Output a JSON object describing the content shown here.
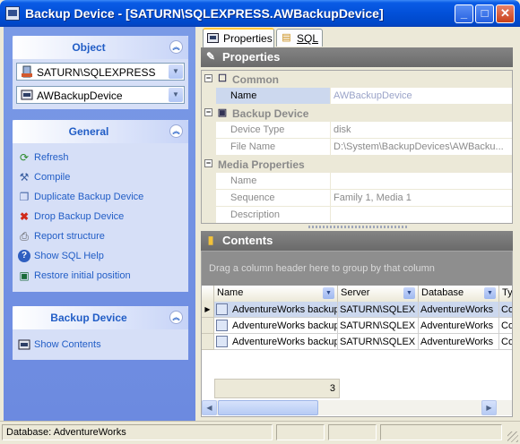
{
  "window": {
    "title": "Backup Device - [SATURN\\SQLEXPRESS.AWBackupDevice]",
    "min_glyph": "_",
    "max_glyph": "□",
    "close_glyph": "✕"
  },
  "left_pane": {
    "object_panel": {
      "title": "Object",
      "server": "SATURN\\SQLEXPRESS",
      "device": "AWBackupDevice"
    },
    "general_panel": {
      "title": "General",
      "items": [
        {
          "label": "Refresh",
          "icon": "refresh-icon"
        },
        {
          "label": "Compile",
          "icon": "compile-icon"
        },
        {
          "label": "Duplicate Backup Device",
          "icon": "duplicate-icon"
        },
        {
          "label": "Drop Backup Device",
          "icon": "drop-icon"
        },
        {
          "label": "Report structure",
          "icon": "report-icon"
        },
        {
          "label": "Show SQL Help",
          "icon": "help-icon"
        },
        {
          "label": "Restore initial position",
          "icon": "restore-icon"
        }
      ]
    },
    "backup_panel": {
      "title": "Backup Device",
      "items": [
        {
          "label": "Show Contents",
          "icon": "show-contents-icon"
        }
      ]
    }
  },
  "tabs": [
    {
      "label": "Properties",
      "active": true
    },
    {
      "label": "SQL",
      "active": false
    }
  ],
  "properties": {
    "title": "Properties",
    "categories": [
      {
        "name": "Common",
        "rows": [
          {
            "name": "Name",
            "value": "AWBackupDevice",
            "selected": true
          }
        ]
      },
      {
        "name": "Backup Device",
        "rows": [
          {
            "name": "Device Type",
            "value": "disk"
          },
          {
            "name": "File Name",
            "value": "D:\\System\\BackupDevices\\AWBacku..."
          }
        ]
      },
      {
        "name": "Media Properties",
        "rows": [
          {
            "name": "Name",
            "value": ""
          },
          {
            "name": "Sequence",
            "value": "Family 1, Media 1"
          },
          {
            "name": "Description",
            "value": ""
          }
        ]
      }
    ]
  },
  "contents": {
    "title": "Contents",
    "group_hint": "Drag a column header here to group by that column",
    "columns": [
      "Name",
      "Server",
      "Database",
      "Ty"
    ],
    "rows": [
      [
        "AdventureWorks backup",
        "SATURN\\SQLEX",
        "AdventureWorks",
        "Co"
      ],
      [
        "AdventureWorks backup",
        "SATURN\\SQLEX",
        "AdventureWorks",
        "Co"
      ],
      [
        "AdventureWorks backup",
        "SATURN\\SQLEX",
        "AdventureWorks",
        "Co"
      ]
    ],
    "row_count": "3"
  },
  "status": {
    "database": "Database: AdventureWorks"
  }
}
